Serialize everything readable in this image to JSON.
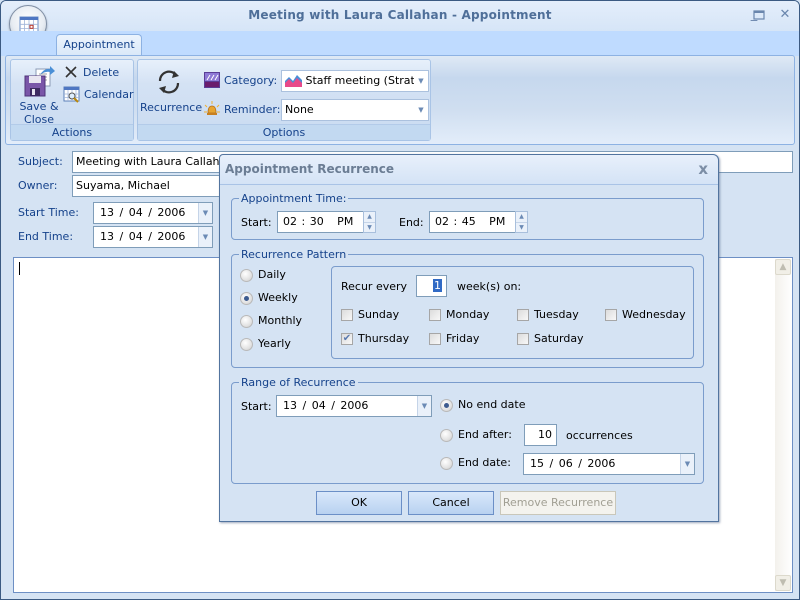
{
  "window": {
    "title": "Meeting with Laura Callahan - Appointment",
    "controls": {
      "minimize": "_",
      "maximize": "▭",
      "close": "✕"
    },
    "orb_icon": "calendar-icon"
  },
  "ribbon": {
    "tabs": [
      {
        "label": "Appointment",
        "active": true
      }
    ],
    "groups": {
      "actions": {
        "label": "Actions",
        "save_close": "Save & Close",
        "save_close_line1": "Save &",
        "save_close_line2": "Close",
        "delete": "Delete",
        "calendar": "Calendar"
      },
      "options": {
        "label": "Options",
        "recurrence": "Recurrence",
        "category_label": "Category:",
        "category_value": "Staff meeting (Strategie",
        "reminder_label": "Reminder:",
        "reminder_value": "None"
      }
    }
  },
  "form": {
    "subject_label": "Subject:",
    "subject_value": "Meeting with Laura Callahan",
    "owner_label": "Owner:",
    "owner_value": "Suyama, Michael",
    "start_label": "Start Time:",
    "start_value": "13 / 04 / 2006",
    "end_label": "End Time:",
    "end_value": "13 / 04 / 2006",
    "notes": ""
  },
  "dialog": {
    "title": "Appointment Recurrence",
    "close": "x",
    "appointment_time": {
      "legend": "Appointment Time:",
      "start_label": "Start:",
      "start_value": "02 : 30   PM",
      "end_label": "End:",
      "end_value": "02 : 45   PM"
    },
    "pattern": {
      "legend": "Recurrence Pattern",
      "options": [
        {
          "label": "Daily",
          "selected": false
        },
        {
          "label": "Weekly",
          "selected": true
        },
        {
          "label": "Monthly",
          "selected": false
        },
        {
          "label": "Yearly",
          "selected": false
        }
      ],
      "recur_every_label": "Recur every",
      "recur_every_value": "1",
      "weeks_on_label": "week(s) on:",
      "days": [
        {
          "label": "Sunday",
          "checked": false
        },
        {
          "label": "Monday",
          "checked": false
        },
        {
          "label": "Tuesday",
          "checked": false
        },
        {
          "label": "Wednesday",
          "checked": false
        },
        {
          "label": "Thursday",
          "checked": true
        },
        {
          "label": "Friday",
          "checked": false
        },
        {
          "label": "Saturday",
          "checked": false
        }
      ]
    },
    "range": {
      "legend": "Range of Recurrence",
      "start_label": "Start:",
      "start_value": "13 / 04 / 2006",
      "no_end_label": "No end date",
      "no_end_selected": true,
      "end_after_label": "End after:",
      "end_after_selected": false,
      "end_after_value": "10",
      "occurrences_label": "occurrences",
      "end_date_label": "End date:",
      "end_date_selected": false,
      "end_date_value": "15 / 06 / 2006"
    },
    "buttons": {
      "ok": "OK",
      "cancel": "Cancel",
      "remove": "Remove Recurrence"
    }
  }
}
